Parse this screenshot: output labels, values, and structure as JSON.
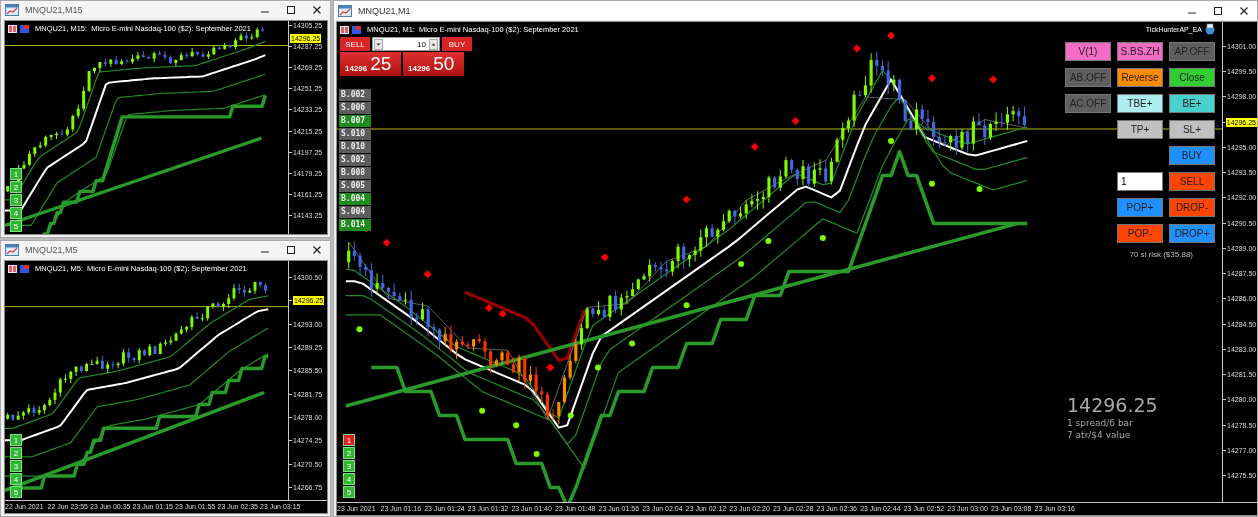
{
  "windows": [
    {
      "title": "MNQU21,M15",
      "active": false,
      "chart_header": "MNQU21, M15:  Micro E-mini Nasdaq-100 ($2): September 2021",
      "current_price": "14296.25",
      "price_ticks": [
        {
          "label": "14305.25",
          "kind": "tick"
        },
        {
          "label": "14287.25",
          "kind": "tick"
        },
        {
          "label": "14269.25",
          "kind": "tick"
        },
        {
          "label": "14251.25",
          "kind": "tick"
        },
        {
          "label": "14233.25",
          "kind": "tick"
        },
        {
          "label": "14215.25",
          "kind": "tick"
        },
        {
          "label": "14197.25",
          "kind": "tick"
        },
        {
          "label": "14179.25",
          "kind": "tick"
        },
        {
          "label": "14161.25",
          "kind": "tick"
        },
        {
          "label": "14143.25",
          "kind": "tick"
        }
      ],
      "level_buttons": [
        {
          "label": "1",
          "color": "#2fb82f"
        },
        {
          "label": "2",
          "color": "#2fb82f"
        },
        {
          "label": "3",
          "color": "#2fb82f"
        },
        {
          "label": "4",
          "color": "#2fb82f"
        },
        {
          "label": "5",
          "color": "#2fb82f"
        }
      ]
    },
    {
      "title": "MNQU21,M5",
      "active": false,
      "chart_header": "MNQU21, M5:  Micro E-mini Nasdaq-100 ($2): September 2021",
      "price_ticks": [
        {
          "label": "14300.50",
          "kind": "tick"
        },
        {
          "label": "14296.25",
          "kind": "current"
        },
        {
          "label": "14293.00",
          "kind": "tick"
        },
        {
          "label": "14289.25",
          "kind": "tick"
        },
        {
          "label": "14285.50",
          "kind": "tick"
        },
        {
          "label": "14281.75",
          "kind": "tick"
        },
        {
          "label": "14278.00",
          "kind": "tick"
        },
        {
          "label": "14274.25",
          "kind": "tick"
        },
        {
          "label": "14270.50",
          "kind": "tick"
        },
        {
          "label": "14266.75",
          "kind": "tick"
        }
      ],
      "time_ticks": [
        "22 Jun 2021",
        "22 Jun 23:55",
        "23 Jun 00:35",
        "23 Jun 01:15",
        "23 Jun 01:55",
        "23 Jun 02:35",
        "23 Jun 03:15"
      ],
      "level_buttons": [
        {
          "label": "1",
          "color": "#2fb82f"
        },
        {
          "label": "2",
          "color": "#2fb82f"
        },
        {
          "label": "3",
          "color": "#2fb82f"
        },
        {
          "label": "4",
          "color": "#2fb82f"
        },
        {
          "label": "5",
          "color": "#2fb82f"
        }
      ]
    },
    {
      "title": "MNQU21,M1",
      "active": true,
      "chart_header": "MNQU21, M1:  Micro E-mini Nasdaq-100 ($2): September 2021",
      "price_ticks": [
        {
          "label": "14301.00",
          "kind": "tick"
        },
        {
          "label": "14299.50",
          "kind": "tick"
        },
        {
          "label": "14298.00",
          "kind": "tick"
        },
        {
          "label": "14296.25",
          "kind": "current"
        },
        {
          "label": "14295.00",
          "kind": "tick"
        },
        {
          "label": "14293.50",
          "kind": "tick"
        },
        {
          "label": "14292.00",
          "kind": "tick"
        },
        {
          "label": "14290.50",
          "kind": "tick"
        },
        {
          "label": "14289.00",
          "kind": "tick"
        },
        {
          "label": "14287.50",
          "kind": "tick"
        },
        {
          "label": "14286.00",
          "kind": "tick"
        },
        {
          "label": "14284.50",
          "kind": "tick"
        },
        {
          "label": "14283.00",
          "kind": "tick"
        },
        {
          "label": "14281.50",
          "kind": "tick"
        },
        {
          "label": "14280.00",
          "kind": "tick"
        },
        {
          "label": "14278.50",
          "kind": "tick"
        },
        {
          "label": "14277.00",
          "kind": "tick"
        },
        {
          "label": "14275.50",
          "kind": "tick"
        }
      ],
      "time_ticks": [
        "23 Jun 2021",
        "23 Jun 01:16",
        "23 Jun 01:24",
        "23 Jun 01:32",
        "23 Jun 01:40",
        "23 Jun 01:48",
        "23 Jun 01:56",
        "23 Jun 02:04",
        "23 Jun 02:12",
        "23 Jun 02:20",
        "23 Jun 02:28",
        "23 Jun 02:36",
        "23 Jun 02:44",
        "23 Jun 02:52",
        "23 Jun 03:00",
        "23 Jun 03:08",
        "23 Jun 03:16"
      ],
      "level_buttons": [
        {
          "label": "1",
          "color": "#e02020"
        },
        {
          "label": "2",
          "color": "#2fb82f"
        },
        {
          "label": "3",
          "color": "#2fb82f"
        },
        {
          "label": "4",
          "color": "#2fb82f"
        },
        {
          "label": "5",
          "color": "#2fb82f"
        }
      ],
      "ea_name": "TickHunterAP_EA",
      "trade_panel": {
        "sell_label": "SELL",
        "buy_label": "BUY",
        "lots": "10",
        "sell_price_major": "14296",
        "sell_price_minor": "25",
        "buy_price_major": "14296",
        "buy_price_minor": "50"
      },
      "trade_labels": [
        {
          "label": "B.002",
          "color": "#5c5c5c"
        },
        {
          "label": "S.006",
          "color": "#5c5c5c"
        },
        {
          "label": "B.007",
          "color": "#1e8c1e"
        },
        {
          "label": "S.010",
          "color": "#5c5c5c"
        },
        {
          "label": "B.010",
          "color": "#5c5c5c"
        },
        {
          "label": "S.002",
          "color": "#5c5c5c"
        },
        {
          "label": "B.008",
          "color": "#5c5c5c"
        },
        {
          "label": "S.005",
          "color": "#5c5c5c"
        },
        {
          "label": "B.004",
          "color": "#1e8c1e"
        },
        {
          "label": "S.004",
          "color": "#5c5c5c"
        },
        {
          "label": "B.014",
          "color": "#1e8c1e"
        }
      ],
      "control_rows": [
        [
          {
            "kind": "button",
            "label": "V(1)",
            "color": "#f46cc4"
          },
          {
            "kind": "button",
            "label": "S.BS.ZH",
            "color": "#f46cc4"
          },
          {
            "kind": "button",
            "label": "AP.OFF",
            "color": "#5f5f5f"
          }
        ],
        [
          {
            "kind": "button",
            "label": "AB.OFF",
            "color": "#5f5f5f"
          },
          {
            "kind": "button",
            "label": "Reverse",
            "color": "#ff8c00"
          },
          {
            "kind": "button",
            "label": "Close",
            "color": "#32cd32"
          }
        ],
        [
          {
            "kind": "button",
            "label": "AC.OFF",
            "color": "#5f5f5f"
          },
          {
            "kind": "button",
            "label": "TBE+",
            "color": "#afeeee"
          },
          {
            "kind": "button",
            "label": "BE+",
            "color": "#48d1cc"
          }
        ],
        [
          {
            "kind": "button",
            "label": "TP+",
            "color": "#c0c0c0"
          },
          {
            "kind": "button",
            "label": "SL+",
            "color": "#c0c0c0"
          }
        ],
        [
          {
            "kind": "button",
            "label": "BUY",
            "color": "#1e90ff"
          }
        ],
        [
          {
            "kind": "input",
            "label": "1"
          },
          {
            "kind": "button",
            "label": "SELL",
            "color": "#ff4500"
          }
        ],
        [
          {
            "kind": "button",
            "label": "POP+",
            "color": "#1e90ff"
          },
          {
            "kind": "button",
            "label": "DROP-",
            "color": "#ff4500"
          }
        ],
        [
          {
            "kind": "button",
            "label": "POP-",
            "color": "#ff4500"
          },
          {
            "kind": "button",
            "label": "DROP+",
            "color": "#1e90ff"
          }
        ]
      ],
      "risk_text": "70 sl risk ($35.88)",
      "info": {
        "price": "14296.25",
        "lines": [
          "1 spread/6 bar",
          "7 atr/$4 value"
        ]
      }
    }
  ]
}
